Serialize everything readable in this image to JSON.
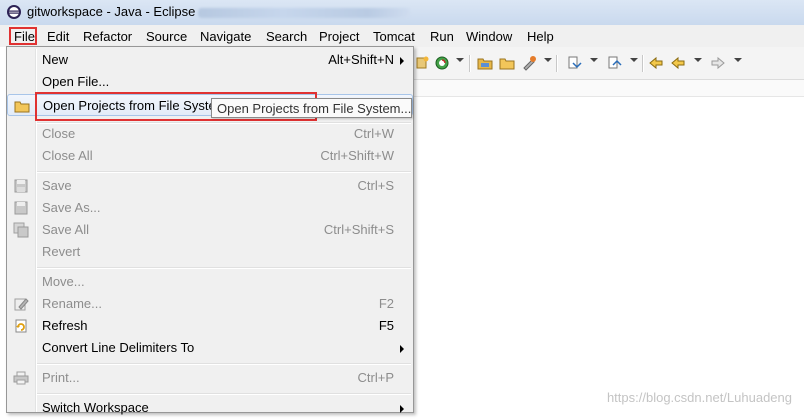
{
  "window": {
    "title": "gitworkspace - Java - Eclipse"
  },
  "menubar": {
    "items": [
      "File",
      "Edit",
      "Refactor",
      "Source",
      "Navigate",
      "Search",
      "Project",
      "Tomcat",
      "Run",
      "Window",
      "Help"
    ]
  },
  "file_menu": {
    "items": [
      {
        "label": "New",
        "accel": "Alt+Shift+N",
        "submenu": true,
        "enabled": true
      },
      {
        "label": "Open File...",
        "accel": "",
        "enabled": true
      },
      {
        "label": "Open Projects from File System...",
        "accel": "",
        "enabled": true,
        "icon": "folder-icon"
      },
      {
        "label": "Close",
        "accel": "Ctrl+W",
        "enabled": false
      },
      {
        "label": "Close All",
        "accel": "Ctrl+Shift+W",
        "enabled": false
      },
      {
        "label": "Save",
        "accel": "Ctrl+S",
        "enabled": false,
        "icon": "save-icon"
      },
      {
        "label": "Save As...",
        "accel": "",
        "enabled": false,
        "icon": "save-as-icon"
      },
      {
        "label": "Save All",
        "accel": "Ctrl+Shift+S",
        "enabled": false,
        "icon": "save-all-icon"
      },
      {
        "label": "Revert",
        "accel": "",
        "enabled": false
      },
      {
        "label": "Move...",
        "accel": "",
        "enabled": false
      },
      {
        "label": "Rename...",
        "accel": "F2",
        "enabled": false,
        "icon": "rename-icon"
      },
      {
        "label": "Refresh",
        "accel": "F5",
        "enabled": true,
        "icon": "refresh-icon"
      },
      {
        "label": "Convert Line Delimiters To",
        "accel": "",
        "submenu": true,
        "enabled": true
      },
      {
        "label": "Print...",
        "accel": "Ctrl+P",
        "enabled": false,
        "icon": "print-icon"
      },
      {
        "label": "Switch Workspace",
        "accel": "",
        "submenu": true,
        "enabled": true
      }
    ]
  },
  "open_projects_item_visible_label": "Open Projects from File Syste",
  "tooltip": {
    "text": "Open Projects from File System..."
  },
  "watermark": "https://blog.csdn.net/Luhuadeng",
  "colors": {
    "highlight_box": "#e03232",
    "menu_bg": "#f0f0f0",
    "disabled_text": "#8d8d8d"
  }
}
